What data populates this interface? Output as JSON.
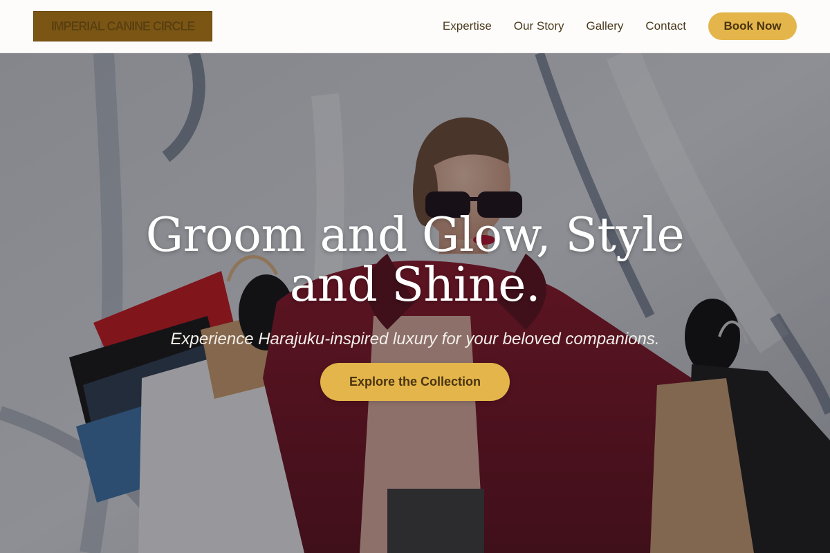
{
  "brand": {
    "name": "IMPERIAL CANINE CIRCLE"
  },
  "nav": {
    "links": [
      {
        "label": "Expertise"
      },
      {
        "label": "Our Story"
      },
      {
        "label": "Gallery"
      },
      {
        "label": "Contact"
      }
    ],
    "cta_label": "Book Now"
  },
  "hero": {
    "title": "Groom and Glow, Style and Shine.",
    "subtitle": "Experience Harajuku-inspired luxury for your beloved companions.",
    "cta_label": "Explore the Collection",
    "photo_alt": "woman in sunglasses and red coat holding shopping bags"
  },
  "colors": {
    "accent": "#e3b54a",
    "logo_bg": "#7a5514",
    "nav_text": "#4a3a1c",
    "overlay": "rgba(20,20,28,0.38)"
  }
}
